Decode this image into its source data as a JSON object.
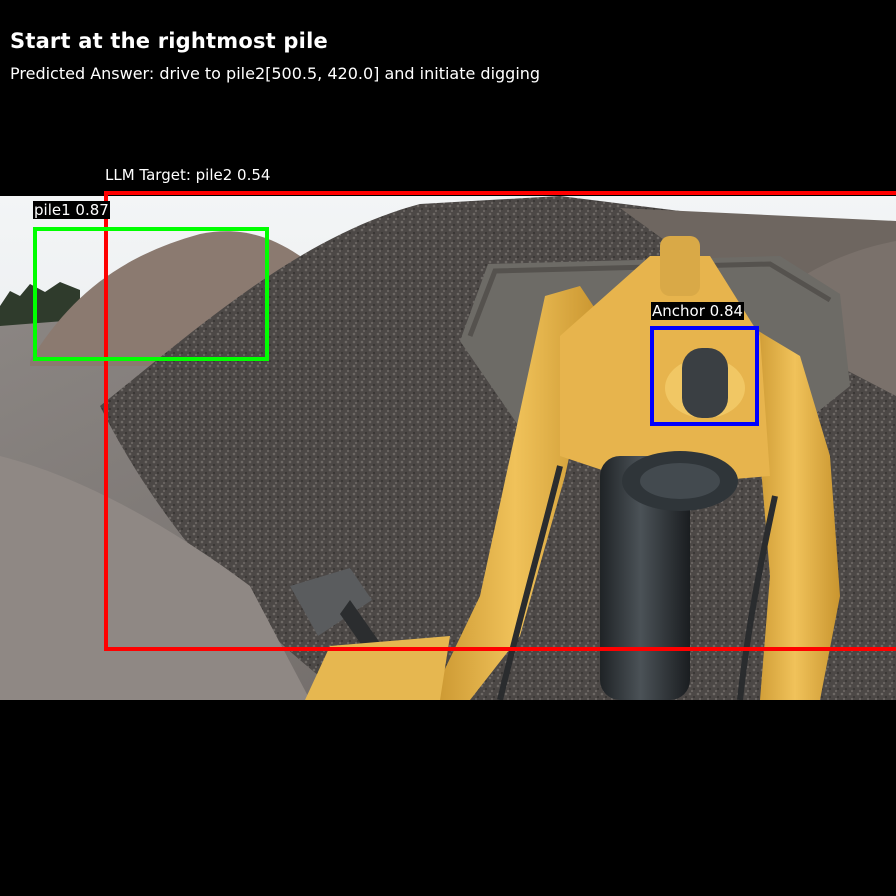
{
  "header": {
    "title": "Start at the rightmost pile",
    "answer": "Predicted Answer: drive to pile2[500.5, 420.0] and initiate digging"
  },
  "detections": {
    "target": {
      "label": "LLM Target: pile2 0.54",
      "color": "#ff0000"
    },
    "pile1": {
      "label": "pile1 0.87",
      "color": "#00ff00"
    },
    "anchor": {
      "label": "Anchor 0.84",
      "color": "#0000ff"
    }
  },
  "scene": {
    "machine_color": "#e8b54a",
    "sky_color": "#e9edf0",
    "gravel_color": "#4a4644"
  }
}
